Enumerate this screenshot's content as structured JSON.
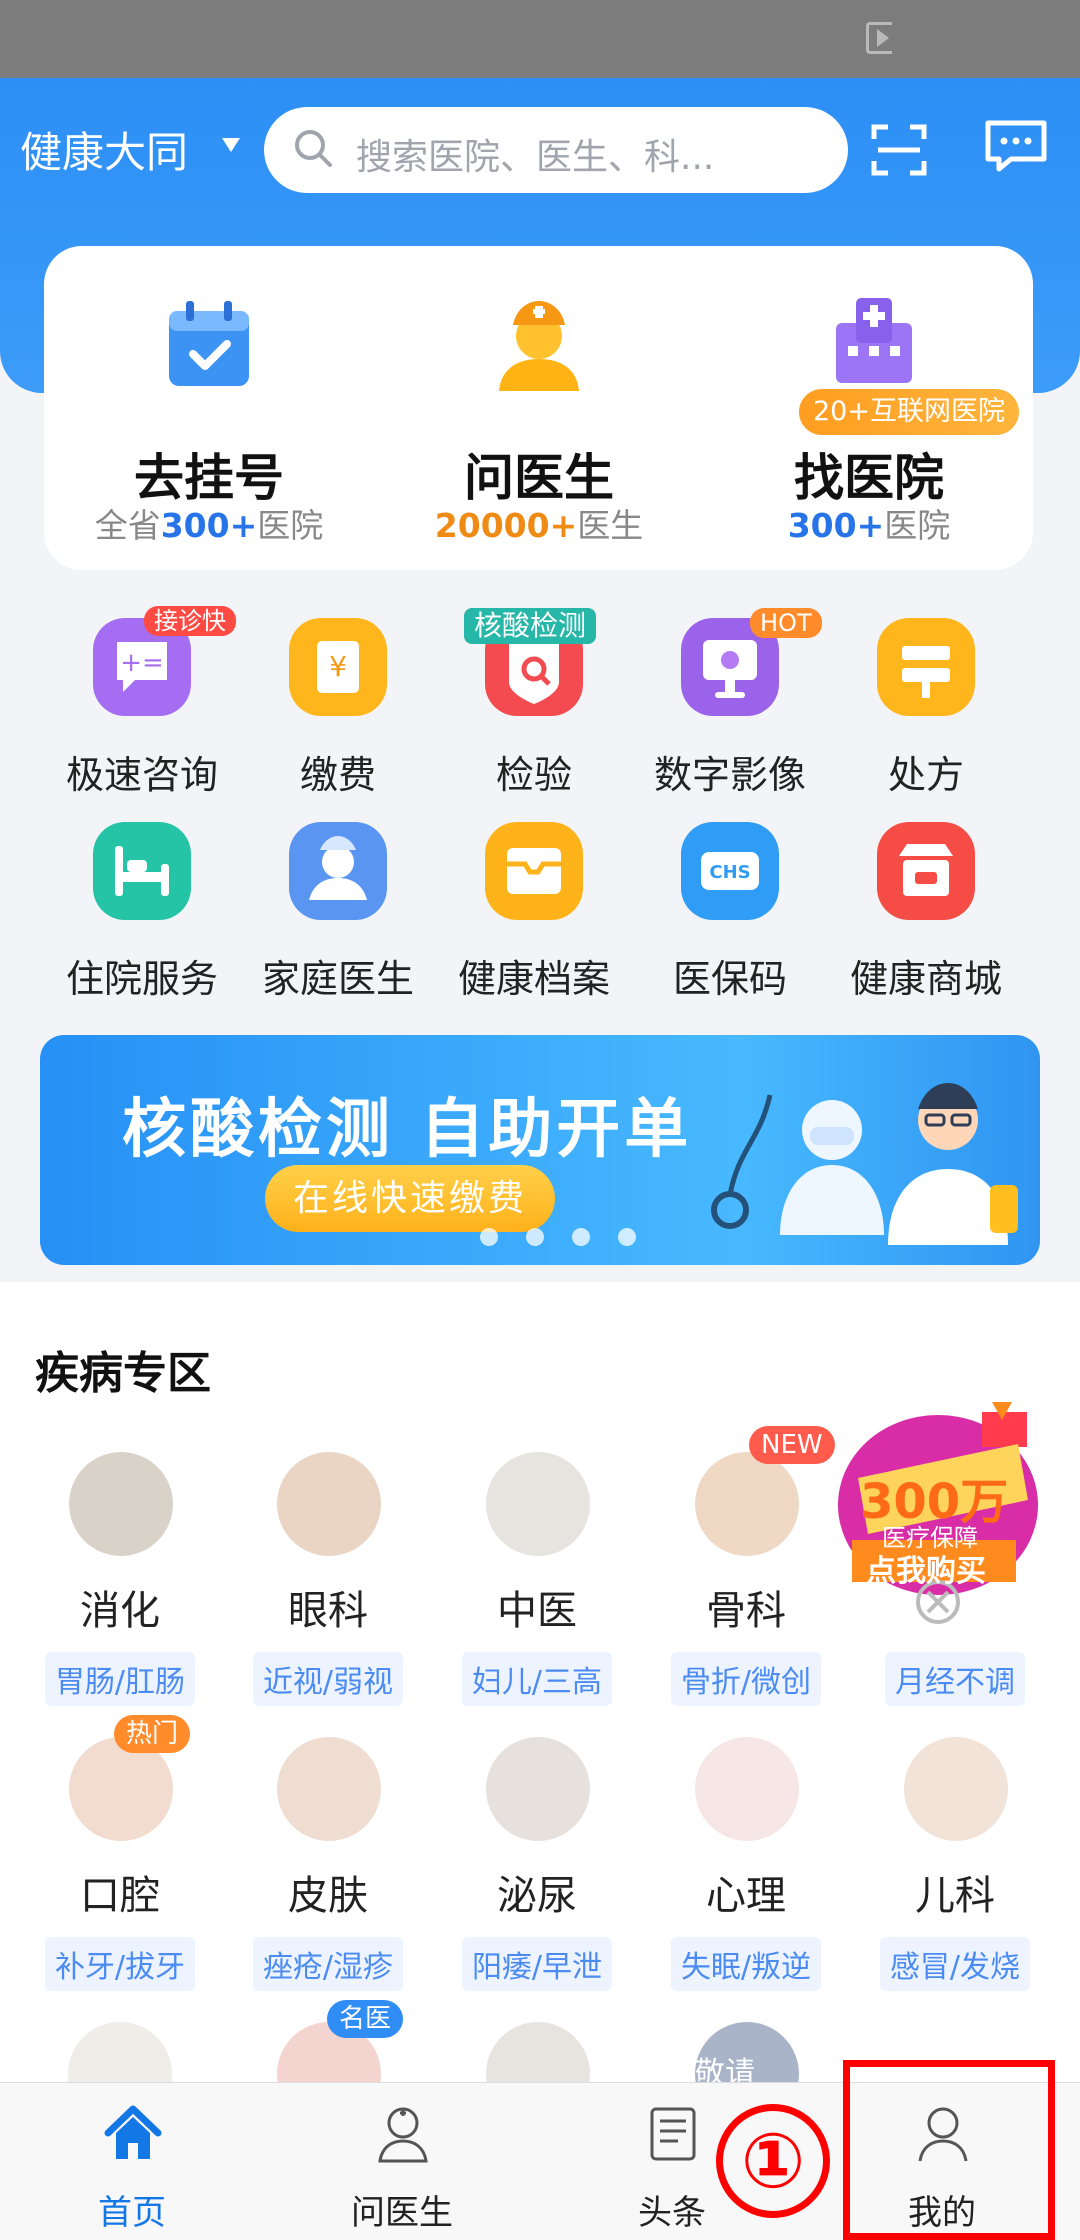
{
  "header": {
    "city": "健康大同",
    "search_placeholder": "搜索医院、医生、科..."
  },
  "quick_actions": [
    {
      "title": "去挂号",
      "sub_prefix": "全省",
      "sub_count": "300+",
      "sub_suffix": "医院",
      "accent": "#2674e8"
    },
    {
      "title": "问医生",
      "sub_prefix": "",
      "sub_count": "20000+",
      "sub_suffix": "医生",
      "accent": "#ef8b15"
    },
    {
      "title": "找医院",
      "sub_prefix": "",
      "sub_count": "300+",
      "sub_suffix": "医院",
      "accent": "#2674e8",
      "badge": "20+互联网医院"
    }
  ],
  "services": [
    {
      "label": "极速咨询",
      "icon": "chat-icon",
      "badge": "接诊快"
    },
    {
      "label": "缴费",
      "icon": "payment-icon"
    },
    {
      "label": "检验",
      "icon": "lab-test-icon",
      "badge": "核酸检测"
    },
    {
      "label": "数字影像",
      "icon": "image-icon",
      "badge": "HOT"
    },
    {
      "label": "处方",
      "icon": "prescription-icon"
    },
    {
      "label": "住院服务",
      "icon": "bed-icon"
    },
    {
      "label": "家庭医生",
      "icon": "doctor-icon"
    },
    {
      "label": "健康档案",
      "icon": "archive-icon"
    },
    {
      "label": "医保码",
      "icon": "insurance-code-icon",
      "icon_text": "CHS"
    },
    {
      "label": "健康商城",
      "icon": "shop-icon"
    }
  ],
  "banner": {
    "title": "核酸检测 自助开单",
    "button": "在线快速缴费"
  },
  "disease_section": {
    "title": "疾病专区",
    "items": [
      {
        "name": "消化",
        "tag": "胃肠/肛肠"
      },
      {
        "name": "眼科",
        "tag": "近视/弱视"
      },
      {
        "name": "中医",
        "tag": "妇儿/三高"
      },
      {
        "name": "骨科",
        "tag": "骨折/微创",
        "badge": "NEW"
      },
      {
        "name": "",
        "tag": "月经不调"
      },
      {
        "name": "口腔",
        "tag": "补牙/拔牙",
        "badge": "热门"
      },
      {
        "name": "皮肤",
        "tag": "痤疮/湿疹"
      },
      {
        "name": "泌尿",
        "tag": "阳痿/早泄"
      },
      {
        "name": "心理",
        "tag": "失眠/叛逆"
      },
      {
        "name": "儿科",
        "tag": "感冒/发烧"
      }
    ],
    "extra_badge": "名医",
    "extra_avatar_text": "敬请"
  },
  "promo": {
    "amount": "300万",
    "line1": "医疗保障",
    "button": "点我购买"
  },
  "bottom_nav": [
    {
      "label": "首页",
      "active": true
    },
    {
      "label": "问医生"
    },
    {
      "label": "头条"
    },
    {
      "label": "我的"
    }
  ],
  "annotation": {
    "number": "①"
  }
}
